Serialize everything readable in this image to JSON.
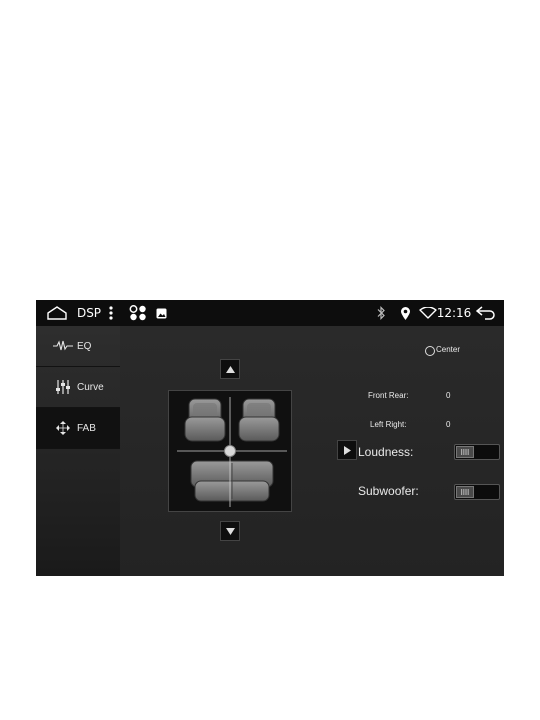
{
  "status_bar": {
    "title": "DSP",
    "time": "12:16",
    "icons": [
      "home-icon",
      "more-vert-icon",
      "apps-icon",
      "image-icon",
      "bluetooth-icon",
      "location-icon",
      "wifi-icon",
      "back-icon"
    ]
  },
  "sidebar": {
    "items": [
      {
        "label": "EQ",
        "icon": "waveform-icon",
        "active": false
      },
      {
        "label": "Curve",
        "icon": "sliders-icon",
        "active": false
      },
      {
        "label": "FAB",
        "icon": "fader-arrows-icon",
        "active": true
      }
    ]
  },
  "fab": {
    "center_label": "Center",
    "front_rear_label": "Front Rear:",
    "front_rear_value": "0",
    "left_right_label": "Left Right:",
    "left_right_value": "0",
    "loudness_label": "Loudness:",
    "subwoofer_label": "Subwoofer:"
  }
}
